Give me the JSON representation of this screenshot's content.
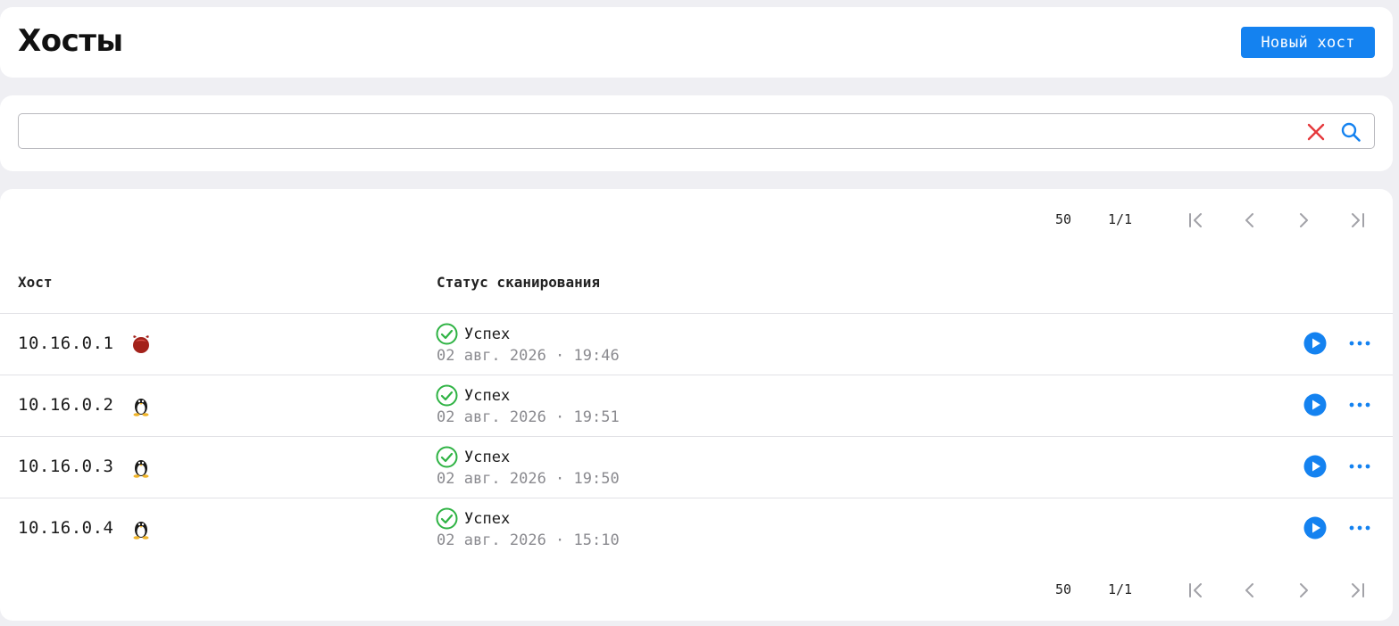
{
  "header": {
    "title": "Хосты",
    "new_host_label": "Новый хост"
  },
  "search": {
    "value": "",
    "placeholder": "",
    "clear_icon": "close-icon",
    "search_icon": "search-icon"
  },
  "pagination": {
    "per_page": "50",
    "page": "1/1"
  },
  "table": {
    "columns": {
      "host": "Хост",
      "scan_status": "Статус сканирования"
    },
    "rows": [
      {
        "host": "10.16.0.1",
        "os": "freebsd-icon",
        "status": "Успех",
        "date": "02 авг. 2026 · 19:46"
      },
      {
        "host": "10.16.0.2",
        "os": "linux-icon",
        "status": "Успех",
        "date": "02 авг. 2026 · 19:51"
      },
      {
        "host": "10.16.0.3",
        "os": "linux-icon",
        "status": "Успех",
        "date": "02 авг. 2026 · 19:50"
      },
      {
        "host": "10.16.0.4",
        "os": "linux-icon",
        "status": "Успех",
        "date": "02 авг. 2026 · 15:10"
      }
    ]
  },
  "colors": {
    "accent": "#1482f0",
    "success": "#2fb344",
    "danger": "#e5383b",
    "muted_text": "#8a8a8f",
    "background": "#efeff3"
  }
}
